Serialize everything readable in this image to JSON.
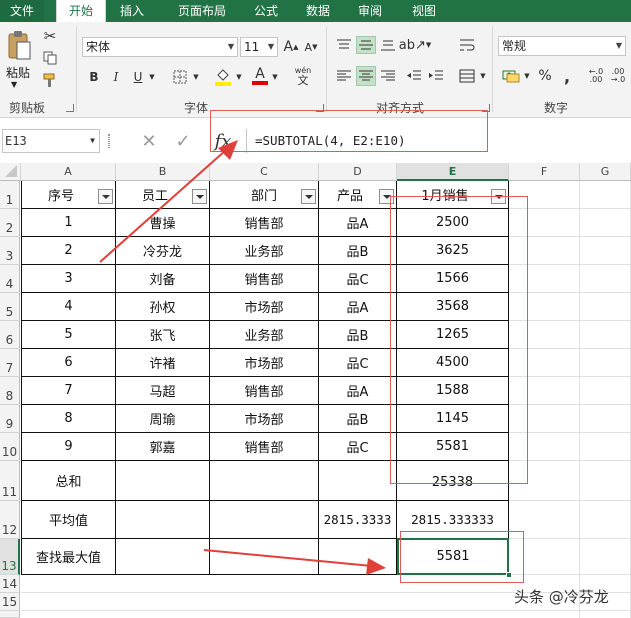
{
  "tabs": [
    "文件",
    "开始",
    "插入",
    "页面布局",
    "公式",
    "数据",
    "审阅",
    "视图"
  ],
  "ribbon": {
    "paste_label": "粘贴",
    "clipboard_label": "剪贴板",
    "font_label": "字体",
    "align_label": "对齐方式",
    "number_label": "数字",
    "font_name": "宋体",
    "font_size": "11",
    "number_format": "常规",
    "bold": "B",
    "italic": "I",
    "underline": "U",
    "percent": "%",
    "wen": "wén",
    "font_color_letter": "A"
  },
  "formula_bar": {
    "name_box": "E13",
    "fx": "fx",
    "formula": "=SUBTOTAL(4, E2:E10)"
  },
  "columns": [
    "A",
    "B",
    "C",
    "D",
    "E",
    "F",
    "G"
  ],
  "rows": [
    "1",
    "2",
    "3",
    "4",
    "5",
    "6",
    "7",
    "8",
    "9",
    "10",
    "11",
    "12",
    "13",
    "14",
    "15"
  ],
  "header": [
    "序号",
    "员工",
    "部门",
    "产品",
    "1月销售"
  ],
  "data": [
    [
      "1",
      "曹操",
      "销售部",
      "品A",
      "2500"
    ],
    [
      "2",
      "冷芬龙",
      "业务部",
      "品B",
      "3625"
    ],
    [
      "3",
      "刘备",
      "销售部",
      "品C",
      "1566"
    ],
    [
      "4",
      "孙权",
      "市场部",
      "品A",
      "3568"
    ],
    [
      "5",
      "张飞",
      "业务部",
      "品B",
      "1265"
    ],
    [
      "6",
      "许褚",
      "市场部",
      "品C",
      "4500"
    ],
    [
      "7",
      "马超",
      "销售部",
      "品A",
      "1588"
    ],
    [
      "8",
      "周瑜",
      "市场部",
      "品B",
      "1145"
    ],
    [
      "9",
      "郭嘉",
      "销售部",
      "品C",
      "5581"
    ]
  ],
  "summary": {
    "sum_label": "总和",
    "sum_value": "25338",
    "avg_label": "平均值",
    "avg_d": "2815.3333",
    "avg_e": "2815.333333",
    "max_label": "查找最大值",
    "max_value": "5581"
  },
  "watermark": "头条 @冷芬龙",
  "colors": {
    "accent": "#217346",
    "annotation": "#e05a5a"
  }
}
